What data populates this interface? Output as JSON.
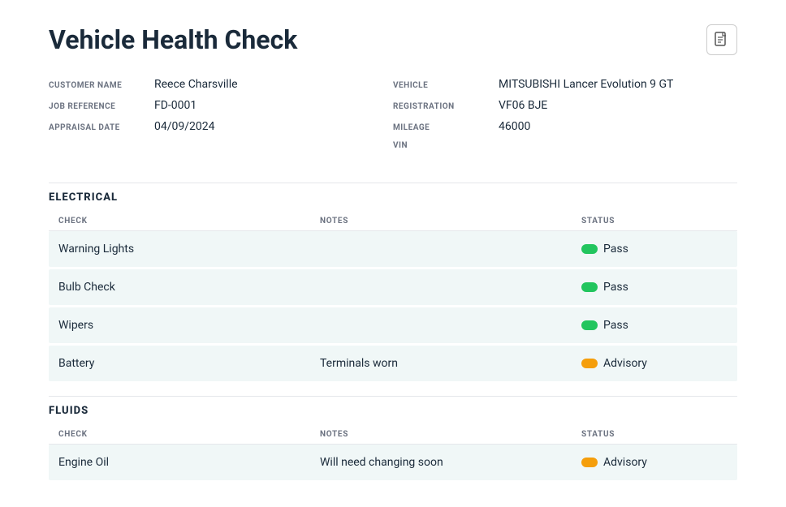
{
  "page": {
    "title": "Vehicle Health Check"
  },
  "meta": {
    "left": [
      {
        "label": "CUSTOMER NAME",
        "value": "Reece Charsville"
      },
      {
        "label": "JOB REFERENCE",
        "value": "FD-0001"
      },
      {
        "label": "APPRAISAL DATE",
        "value": "04/09/2024"
      }
    ],
    "right": [
      {
        "label": "VEHICLE",
        "value": "MITSUBISHI Lancer Evolution 9 GT"
      },
      {
        "label": "REGISTRATION",
        "value": "VF06 BJE"
      },
      {
        "label": "MILEAGE",
        "value": "46000"
      },
      {
        "label": "VIN",
        "value": ""
      }
    ]
  },
  "sections": [
    {
      "title": "ELECTRICAL",
      "columns": [
        "CHECK",
        "NOTES",
        "STATUS"
      ],
      "rows": [
        {
          "check": "Warning Lights",
          "notes": "",
          "status": "Pass",
          "status_type": "pass"
        },
        {
          "check": "Bulb Check",
          "notes": "",
          "status": "Pass",
          "status_type": "pass"
        },
        {
          "check": "Wipers",
          "notes": "",
          "status": "Pass",
          "status_type": "pass"
        },
        {
          "check": "Battery",
          "notes": "Terminals worn",
          "status": "Advisory",
          "status_type": "advisory"
        }
      ]
    },
    {
      "title": "FLUIDS",
      "columns": [
        "CHECK",
        "NOTES",
        "STATUS"
      ],
      "rows": [
        {
          "check": "Engine Oil",
          "notes": "Will need changing soon",
          "status": "Advisory",
          "status_type": "advisory"
        }
      ]
    }
  ],
  "icons": {
    "pdf": "📄"
  }
}
